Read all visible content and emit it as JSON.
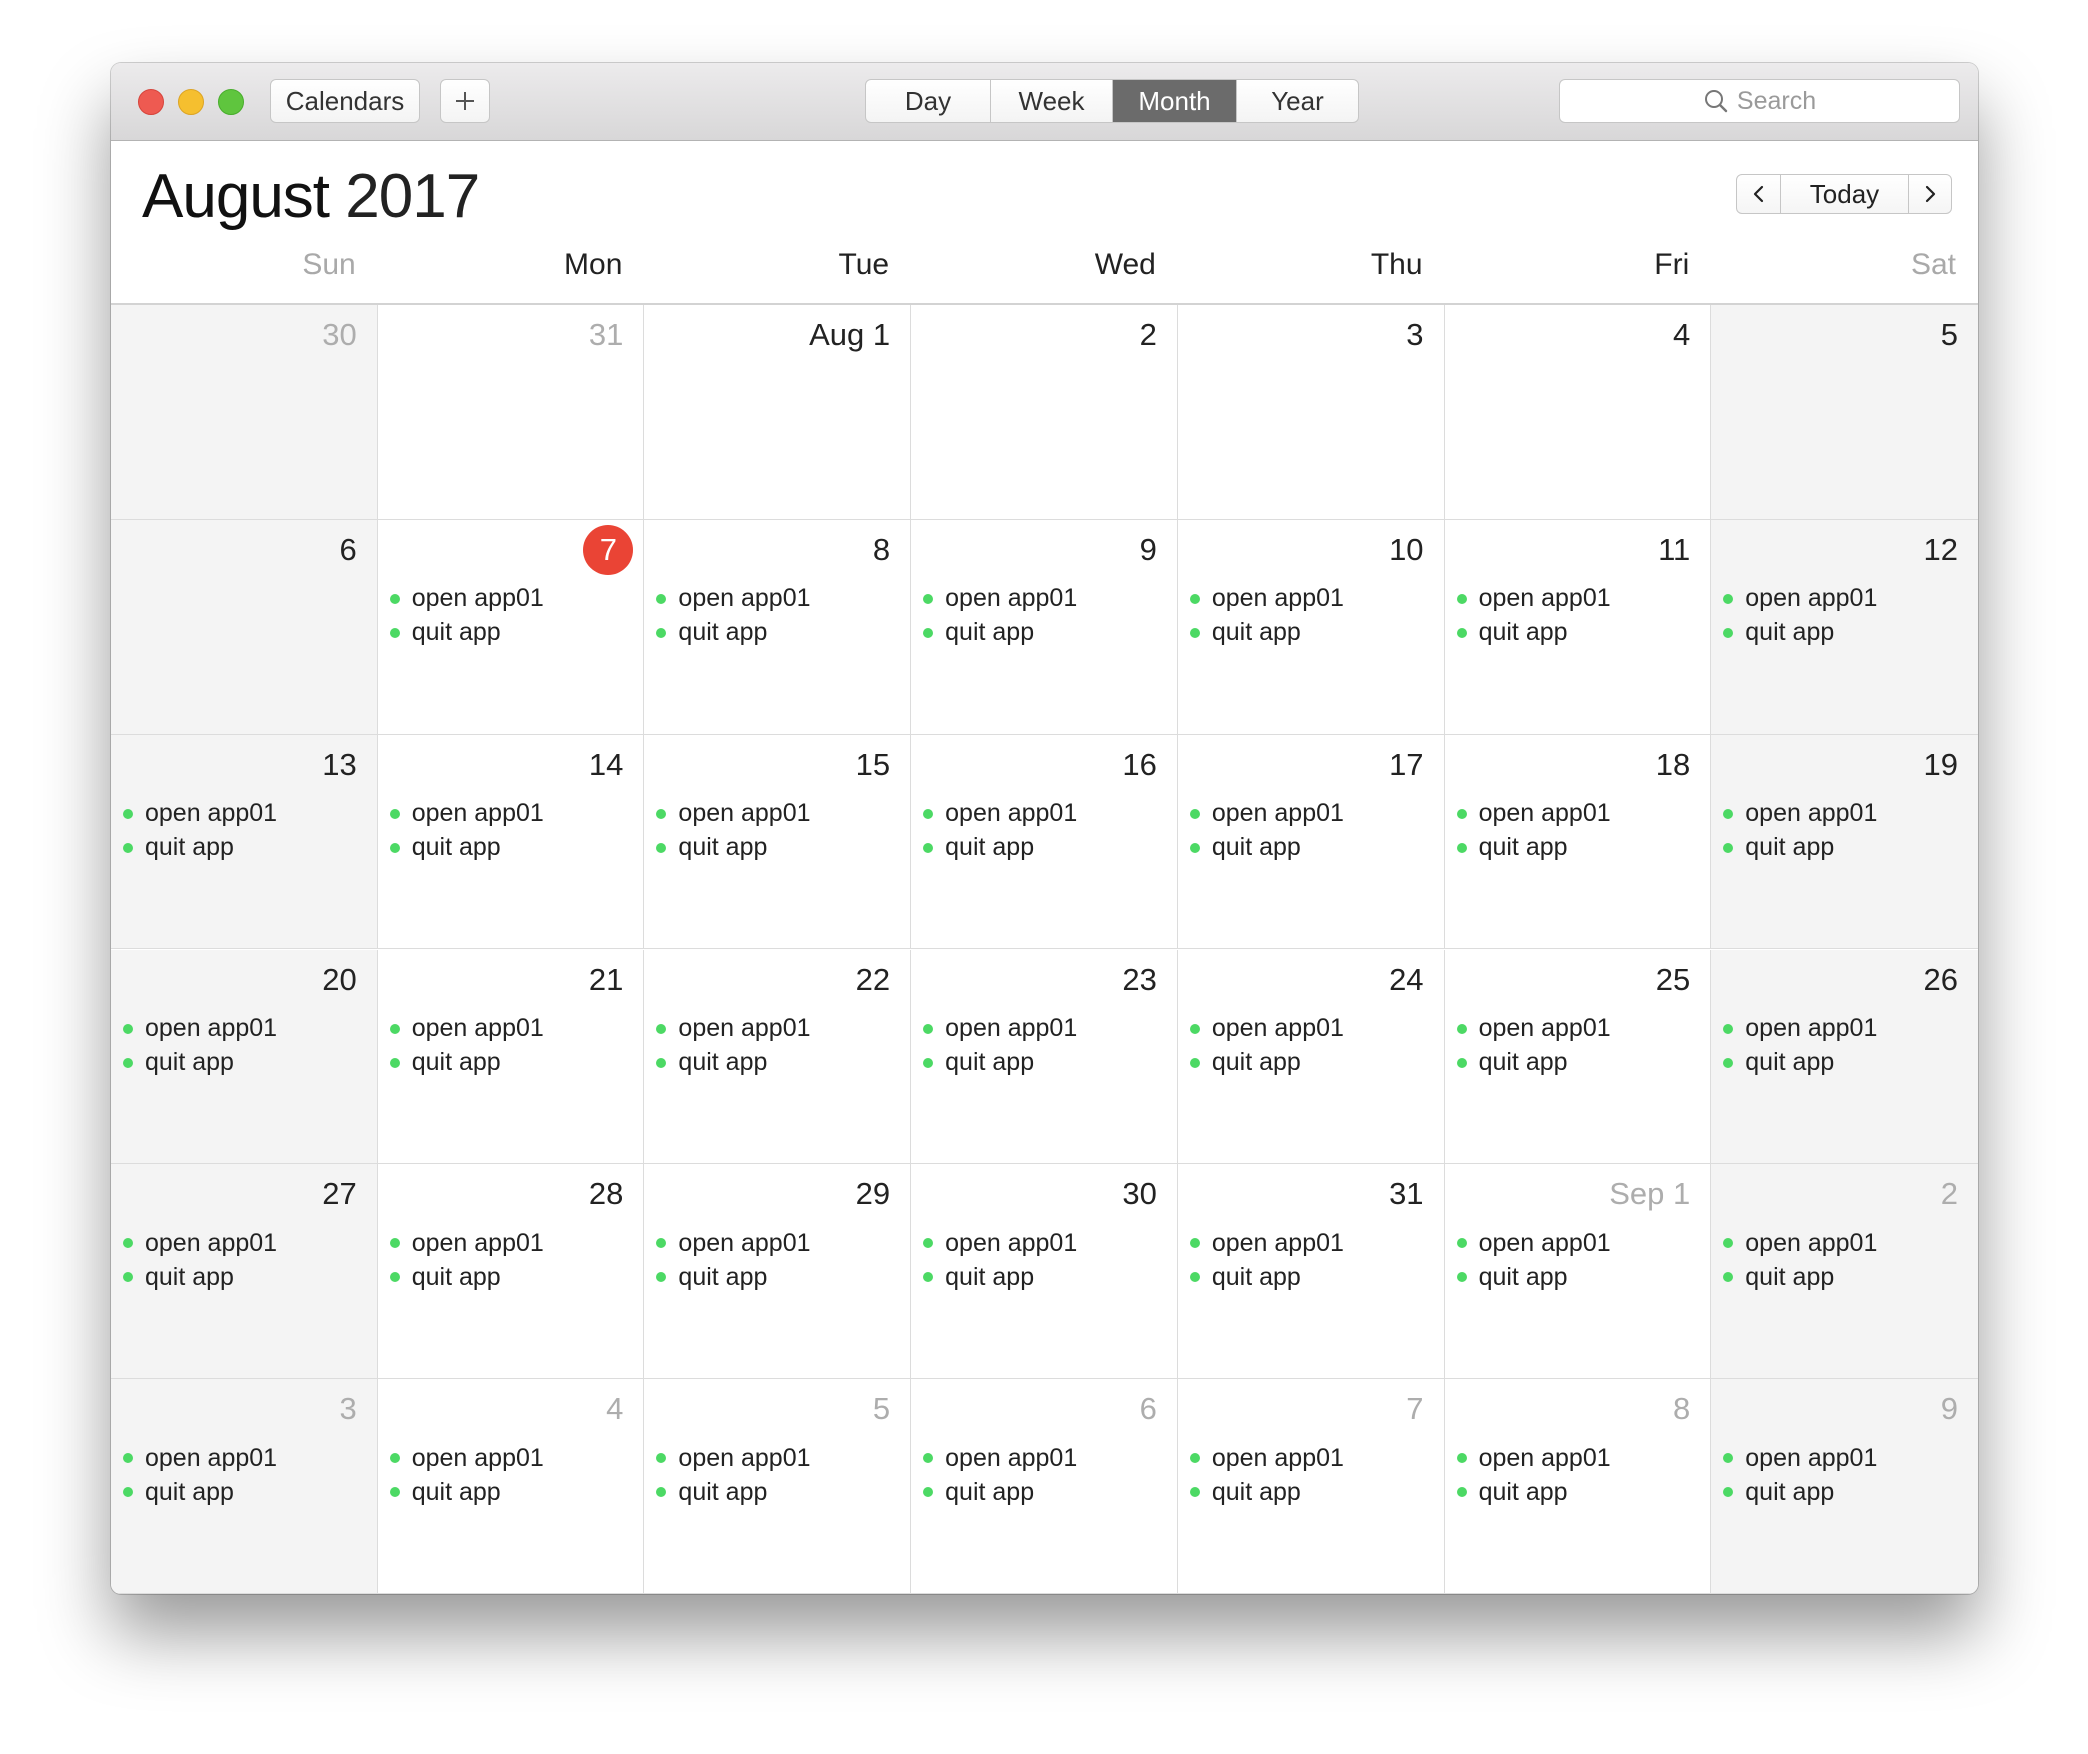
{
  "toolbar": {
    "calendars_label": "Calendars",
    "add_label": "+",
    "views": [
      "Day",
      "Week",
      "Month",
      "Year"
    ],
    "active_view": "Month",
    "search_placeholder": "Search"
  },
  "header": {
    "month": "August",
    "year": "2017",
    "today_label": "Today"
  },
  "weekdays": [
    "Sun",
    "Mon",
    "Tue",
    "Wed",
    "Thu",
    "Fri",
    "Sat"
  ],
  "event_color": "#4cd964",
  "today_color": "#ea4435",
  "weeks": [
    [
      {
        "label": "30",
        "in_month": false,
        "events": []
      },
      {
        "label": "31",
        "in_month": false,
        "events": []
      },
      {
        "label": "Aug 1",
        "in_month": true,
        "events": []
      },
      {
        "label": "2",
        "in_month": true,
        "events": []
      },
      {
        "label": "3",
        "in_month": true,
        "events": []
      },
      {
        "label": "4",
        "in_month": true,
        "events": []
      },
      {
        "label": "5",
        "in_month": true,
        "events": []
      }
    ],
    [
      {
        "label": "6",
        "in_month": true,
        "events": []
      },
      {
        "label": "7",
        "in_month": true,
        "today": true,
        "events": [
          "open app01",
          "quit app"
        ]
      },
      {
        "label": "8",
        "in_month": true,
        "events": [
          "open app01",
          "quit app"
        ]
      },
      {
        "label": "9",
        "in_month": true,
        "events": [
          "open app01",
          "quit app"
        ]
      },
      {
        "label": "10",
        "in_month": true,
        "events": [
          "open app01",
          "quit app"
        ]
      },
      {
        "label": "11",
        "in_month": true,
        "events": [
          "open app01",
          "quit app"
        ]
      },
      {
        "label": "12",
        "in_month": true,
        "events": [
          "open app01",
          "quit app"
        ]
      }
    ],
    [
      {
        "label": "13",
        "in_month": true,
        "events": [
          "open app01",
          "quit app"
        ]
      },
      {
        "label": "14",
        "in_month": true,
        "events": [
          "open app01",
          "quit app"
        ]
      },
      {
        "label": "15",
        "in_month": true,
        "events": [
          "open app01",
          "quit app"
        ]
      },
      {
        "label": "16",
        "in_month": true,
        "events": [
          "open app01",
          "quit app"
        ]
      },
      {
        "label": "17",
        "in_month": true,
        "events": [
          "open app01",
          "quit app"
        ]
      },
      {
        "label": "18",
        "in_month": true,
        "events": [
          "open app01",
          "quit app"
        ]
      },
      {
        "label": "19",
        "in_month": true,
        "events": [
          "open app01",
          "quit app"
        ]
      }
    ],
    [
      {
        "label": "20",
        "in_month": true,
        "events": [
          "open app01",
          "quit app"
        ]
      },
      {
        "label": "21",
        "in_month": true,
        "events": [
          "open app01",
          "quit app"
        ]
      },
      {
        "label": "22",
        "in_month": true,
        "events": [
          "open app01",
          "quit app"
        ]
      },
      {
        "label": "23",
        "in_month": true,
        "events": [
          "open app01",
          "quit app"
        ]
      },
      {
        "label": "24",
        "in_month": true,
        "events": [
          "open app01",
          "quit app"
        ]
      },
      {
        "label": "25",
        "in_month": true,
        "events": [
          "open app01",
          "quit app"
        ]
      },
      {
        "label": "26",
        "in_month": true,
        "events": [
          "open app01",
          "quit app"
        ]
      }
    ],
    [
      {
        "label": "27",
        "in_month": true,
        "events": [
          "open app01",
          "quit app"
        ]
      },
      {
        "label": "28",
        "in_month": true,
        "events": [
          "open app01",
          "quit app"
        ]
      },
      {
        "label": "29",
        "in_month": true,
        "events": [
          "open app01",
          "quit app"
        ]
      },
      {
        "label": "30",
        "in_month": true,
        "events": [
          "open app01",
          "quit app"
        ]
      },
      {
        "label": "31",
        "in_month": true,
        "events": [
          "open app01",
          "quit app"
        ]
      },
      {
        "label": "Sep 1",
        "in_month": false,
        "events": [
          "open app01",
          "quit app"
        ]
      },
      {
        "label": "2",
        "in_month": false,
        "events": [
          "open app01",
          "quit app"
        ]
      }
    ],
    [
      {
        "label": "3",
        "in_month": false,
        "events": [
          "open app01",
          "quit app"
        ]
      },
      {
        "label": "4",
        "in_month": false,
        "events": [
          "open app01",
          "quit app"
        ]
      },
      {
        "label": "5",
        "in_month": false,
        "events": [
          "open app01",
          "quit app"
        ]
      },
      {
        "label": "6",
        "in_month": false,
        "events": [
          "open app01",
          "quit app"
        ]
      },
      {
        "label": "7",
        "in_month": false,
        "events": [
          "open app01",
          "quit app"
        ]
      },
      {
        "label": "8",
        "in_month": false,
        "events": [
          "open app01",
          "quit app"
        ]
      },
      {
        "label": "9",
        "in_month": false,
        "events": [
          "open app01",
          "quit app"
        ]
      }
    ]
  ]
}
